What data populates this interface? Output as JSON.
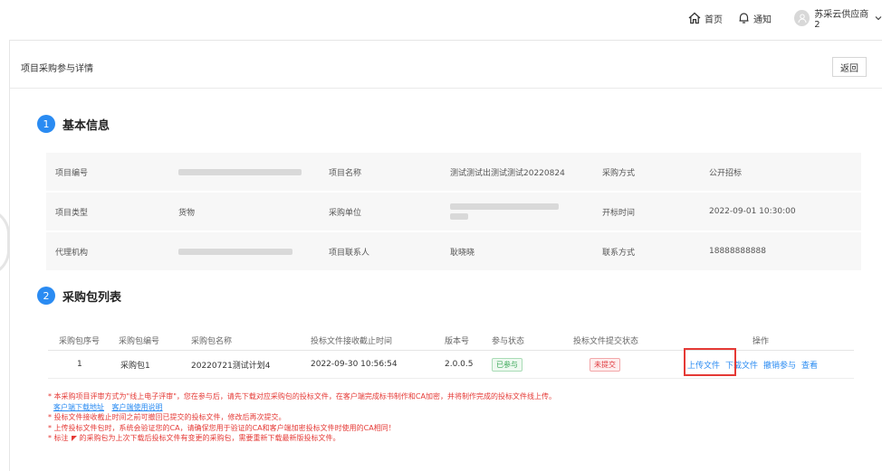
{
  "topbar": {
    "home_label": "首页",
    "notice_label": "通知",
    "user_name": "苏采云供应商2",
    "home_icon": "home-icon",
    "bell_icon": "bell-icon",
    "avatar_icon": "user-avatar-icon",
    "chevron_icon": "chevron-down-icon"
  },
  "page": {
    "title": "项目采购参与详情",
    "back_label": "返回"
  },
  "basic_info": {
    "section_number": "1",
    "section_title": "基本信息",
    "rows": [
      {
        "l1": "项目编号",
        "v1": "",
        "l2": "项目名称",
        "v2": "测试测试出测试测试20220824",
        "l3": "采购方式",
        "v3": "公开招标"
      },
      {
        "l1": "项目类型",
        "v1": "货物",
        "l2": "采购单位",
        "v2": "",
        "l3": "开标时间",
        "v3": "2022-09-01 10:30:00"
      },
      {
        "l1": "代理机构",
        "v1": "",
        "l2": "项目联系人",
        "v2": "耿晓晓",
        "l3": "联系方式",
        "v3": "18888888888"
      }
    ]
  },
  "packages": {
    "section_number": "2",
    "section_title": "采购包列表",
    "headers": [
      "采购包序号",
      "采购包编号",
      "采购包名称",
      "投标文件接收截止时间",
      "版本号",
      "参与状态",
      "投标文件提交状态",
      "操作"
    ],
    "rows": [
      {
        "index": "1",
        "code": "采购包1",
        "name": "20220721测试计划4",
        "deadline": "2022-09-30 10:56:54",
        "version": "2.0.0.5",
        "participation": "已参与",
        "submission": "未提交",
        "actions": [
          "上传文件",
          "下载文件",
          "撤销参与",
          "查看"
        ]
      }
    ],
    "colors": {
      "link": "#2a8bf2",
      "highlight": "#e53935",
      "success": "#3aa757",
      "danger": "#e0393e"
    }
  },
  "notes": {
    "line1": "* 本采购项目评审方式为\"线上电子评审\"，您在参与后，请先下载对应采购包的投标文件，在客户端完成标书制作和CA加密，并将制作完成的投标文件线上传。",
    "links": [
      "客户端下载地址",
      "客户端使用说明"
    ],
    "line2": "* 投标文件接收截止时间之前可撤回已提交的投标文件，修改后再次提交。",
    "line3": "* 上传投标文件包时，系统会验证您的CA，请确保您用于验证的CA和客户端加密投标文件时使用的CA相同！",
    "line4_prefix": "* 标注",
    "line4_suffix": "的采购包为上次下载后投标文件有变更的采购包，需要重新下载最新版投标文件。"
  }
}
